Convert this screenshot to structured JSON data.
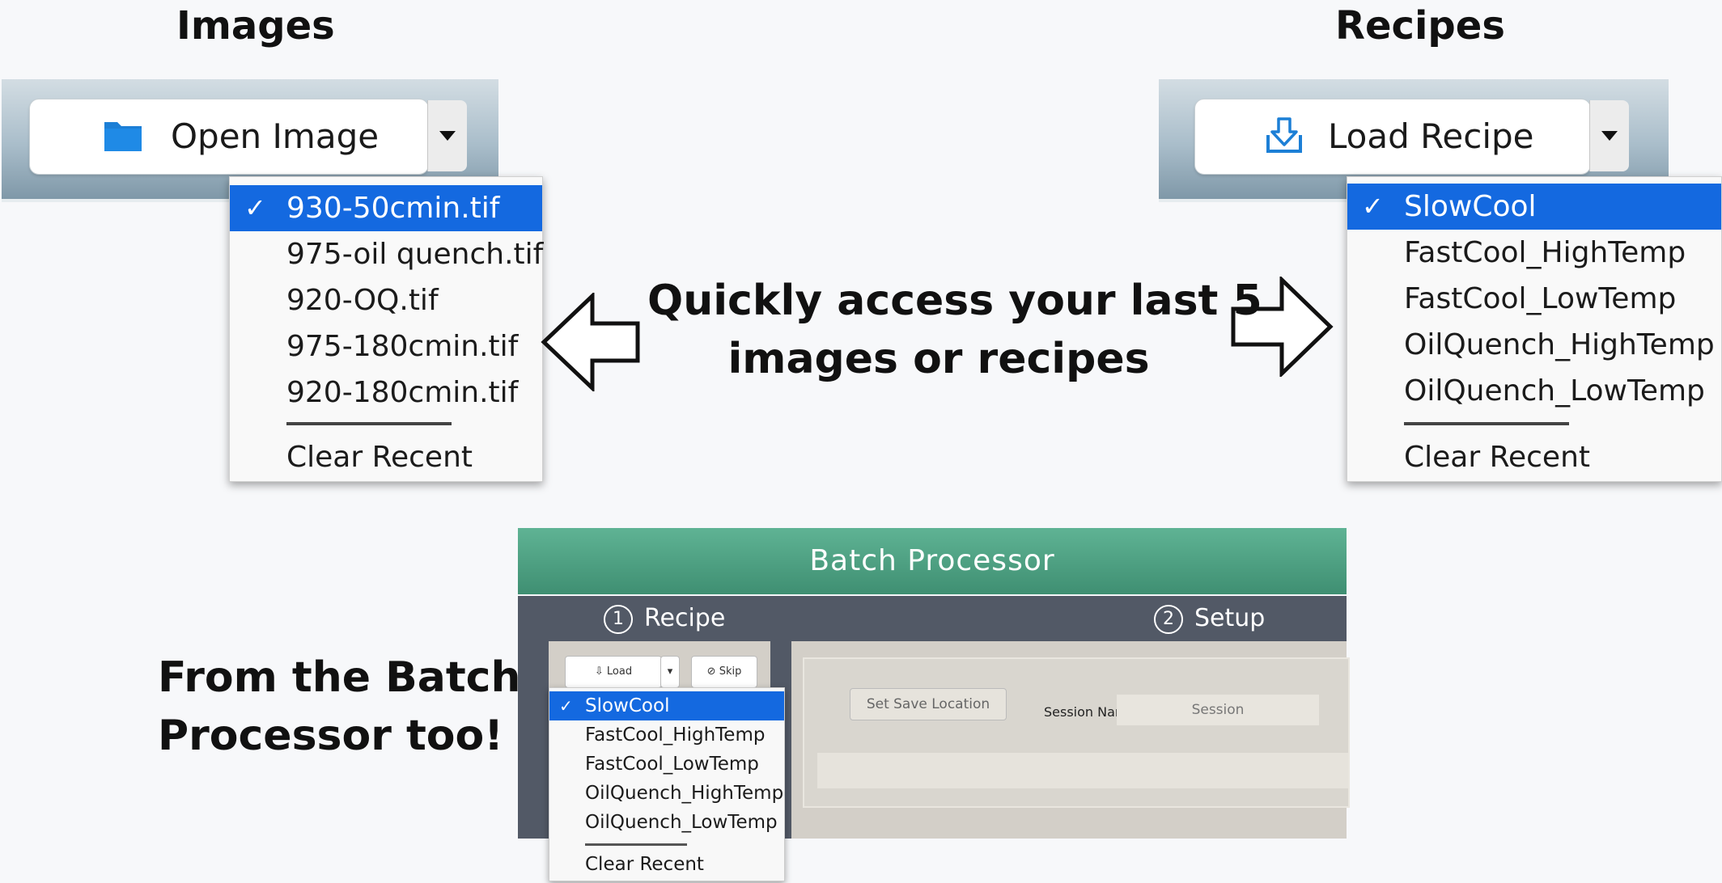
{
  "headings": {
    "images": "Images",
    "recipes": "Recipes"
  },
  "images_toolbar": {
    "button_label": "Open Image",
    "recent": [
      {
        "label": "930-50cmin.tif",
        "selected": true
      },
      {
        "label": "975-oil quench.tif",
        "selected": false
      },
      {
        "label": "920-OQ.tif",
        "selected": false
      },
      {
        "label": "975-180cmin.tif",
        "selected": false
      },
      {
        "label": "920-180cmin.tif",
        "selected": false
      }
    ],
    "clear_label": "Clear Recent"
  },
  "recipes_toolbar": {
    "button_label": "Load Recipe",
    "recent": [
      {
        "label": "SlowCool",
        "selected": true
      },
      {
        "label": "FastCool_HighTemp",
        "selected": false
      },
      {
        "label": "FastCool_LowTemp",
        "selected": false
      },
      {
        "label": "OilQuench_HighTemp",
        "selected": false
      },
      {
        "label": "OilQuench_LowTemp",
        "selected": false
      }
    ],
    "clear_label": "Clear Recent"
  },
  "check_mark": "✓",
  "center_text": {
    "line1": "Quickly access your last 5",
    "line2": "images or recipes"
  },
  "side_text": {
    "line1": "From the Batch",
    "line2": "Processor too!"
  },
  "batch_processor": {
    "title": "Batch Processor",
    "step1": {
      "num": "1",
      "label": "Recipe"
    },
    "step2": {
      "num": "2",
      "label": "Setup"
    },
    "load_label": "Load",
    "skip_label": "Skip",
    "set_save_location": "Set Save Location",
    "session_name_label": "Session Name:",
    "session_placeholder": "Session",
    "recent": [
      {
        "label": "SlowCool",
        "selected": true
      },
      {
        "label": "FastCool_HighTemp",
        "selected": false
      },
      {
        "label": "FastCool_LowTemp",
        "selected": false
      },
      {
        "label": "OilQuench_HighTemp",
        "selected": false
      },
      {
        "label": "OilQuench_LowTemp",
        "selected": false
      }
    ],
    "clear_label": "Clear Recent"
  },
  "colors": {
    "selection": "#1469e0",
    "header_green": "#4ea383",
    "folder_blue": "#1c7fd6"
  }
}
